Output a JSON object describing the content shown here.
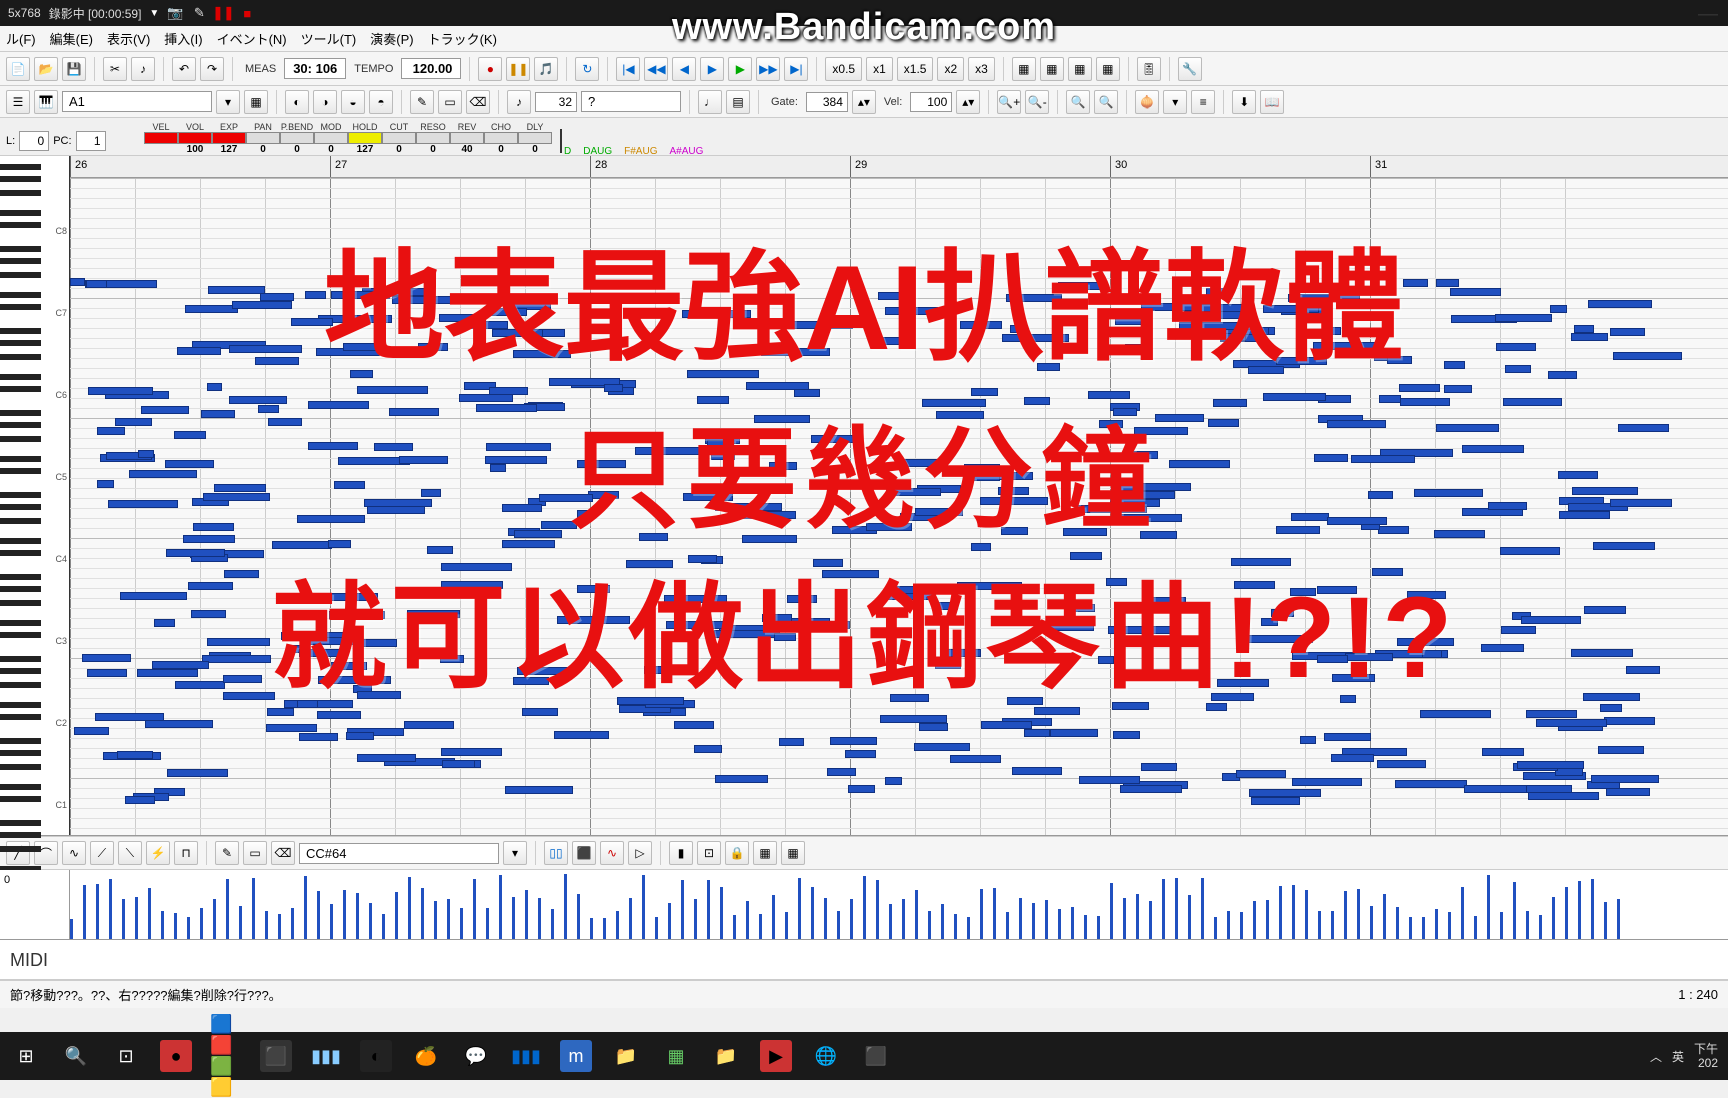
{
  "bandicam": {
    "resolution": "5x768",
    "status": "錄影中 [00:00:59]",
    "watermark": "www.Bandicam.com"
  },
  "menu": {
    "file": "ル(F)",
    "edit": "編集(E)",
    "view": "表示(V)",
    "insert": "挿入(I)",
    "event": "イベント(N)",
    "tool": "ツール(T)",
    "play": "演奏(P)",
    "track": "トラック(K)"
  },
  "transport": {
    "meas_label": "MEAS",
    "meas_value": "30: 106",
    "tempo_label": "TEMPO",
    "tempo_value": "120.00",
    "zoom_labels": [
      "x0.5",
      "x1",
      "x1.5",
      "x2",
      "x3"
    ]
  },
  "track": {
    "selected": "A1",
    "note_val": "32",
    "note_q": "?",
    "gate_label": "Gate:",
    "gate_value": "384",
    "vel_label": "Vel:",
    "vel_value": "100"
  },
  "params": {
    "l_label": "L:",
    "l_value": "0",
    "pc_label": "PC:",
    "pc_value": "1",
    "cells": [
      {
        "lbl": "VEL",
        "val": "",
        "color": "red"
      },
      {
        "lbl": "VOL",
        "val": "100",
        "color": "red"
      },
      {
        "lbl": "EXP",
        "val": "127",
        "color": "red"
      },
      {
        "lbl": "PAN",
        "val": "0",
        "color": ""
      },
      {
        "lbl": "P.BEND",
        "val": "0",
        "color": ""
      },
      {
        "lbl": "MOD",
        "val": "0",
        "color": ""
      },
      {
        "lbl": "HOLD",
        "val": "127",
        "color": "yellow"
      },
      {
        "lbl": "CUT",
        "val": "0",
        "color": ""
      },
      {
        "lbl": "RESO",
        "val": "0",
        "color": ""
      },
      {
        "lbl": "REV",
        "val": "40",
        "color": ""
      },
      {
        "lbl": "CHO",
        "val": "0",
        "color": ""
      },
      {
        "lbl": "DLY",
        "val": "0",
        "color": ""
      }
    ],
    "chords": [
      "D",
      "DAUG",
      "F#AUG",
      "A#AUG"
    ]
  },
  "ruler": {
    "bars": [
      "26",
      "27",
      "28",
      "29",
      "30",
      "31"
    ]
  },
  "overlay": {
    "line1": "地表最強AI扒譜軟體",
    "line2": "只要幾分鐘",
    "line3": "就可以做出鋼琴曲!?!?"
  },
  "cc": {
    "label": "0",
    "selected": "CC#64"
  },
  "midi_label": "MIDI",
  "status": {
    "left": "節?移動???。??、右?????編集?削除?行???。",
    "right": "1 : 240"
  },
  "taskbar": {
    "time_suffix": "下午",
    "date": "202",
    "lang": "英"
  }
}
